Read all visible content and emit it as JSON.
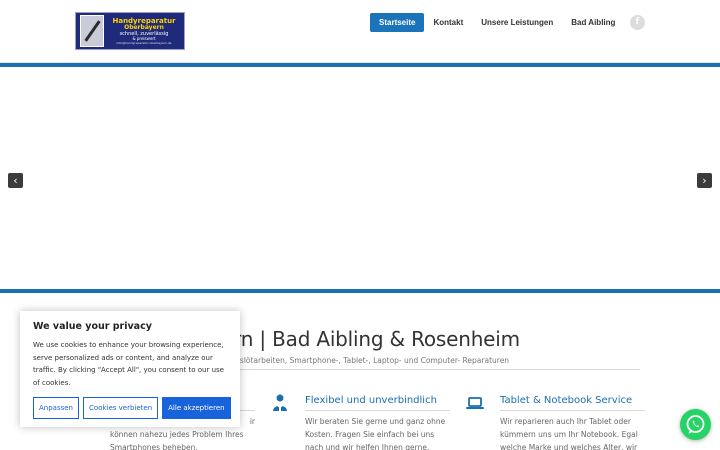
{
  "logo": {
    "line1": "Handyreparatur",
    "line2": "Oberbayern",
    "line3": "schnell, zuverlässig",
    "line4": "& preiswert",
    "line5": "info@handyreparatur-oberbayern.de"
  },
  "nav": {
    "items": [
      {
        "label": "Startseite",
        "active": true
      },
      {
        "label": "Kontakt",
        "active": false
      },
      {
        "label": "Unsere Leistungen",
        "active": false
      },
      {
        "label": "Bad Aibling",
        "active": false
      }
    ],
    "social_icon": "facebook-icon",
    "social_glyph": "f"
  },
  "slider": {
    "prev_glyph": "‹",
    "next_glyph": "›",
    "accent_color": "#1a6fb0"
  },
  "main": {
    "title": "ur Oberbayern | Bad Aibling & Rosenheim",
    "subtitle": "Dienstleistungen, Niederspannungslötarbeiten, Smartphone-, Tablet-, Laptop- und Computer- Reparaturen"
  },
  "features": [
    {
      "icon": "smartphone-icon",
      "title": "",
      "text": "können nahezu jedes Problem Ihres Smartphones beheben.",
      "text_top": "ir"
    },
    {
      "icon": "people-icon",
      "title": "Flexibel und unverbindlich",
      "text": "Wir beraten Sie gerne und ganz ohne Kosten. Fragen Sie einfach bei uns nach und wir helfen Ihnen gerne."
    },
    {
      "icon": "laptop-icon",
      "title": "Tablet & Notebook Service",
      "text": "Wir reparieren auch Ihr Tablet oder kümmern uns um Ihr Notebook. Egal welche Marke und welches Alter, wir"
    }
  ],
  "cookie": {
    "title": "We value your privacy",
    "text": "We use cookies to enhance your browsing experience, serve personalized ads or content, and analyze our traffic. By clicking \"Accept All\", you consent to our use of cookies.",
    "btn_customize": "Anpassen",
    "btn_reject": "Cookies verbieten",
    "btn_accept": "Alle akzeptieren",
    "accent_color": "#1863dc"
  },
  "whatsapp": {
    "icon": "whatsapp-icon",
    "color": "#25d366"
  }
}
